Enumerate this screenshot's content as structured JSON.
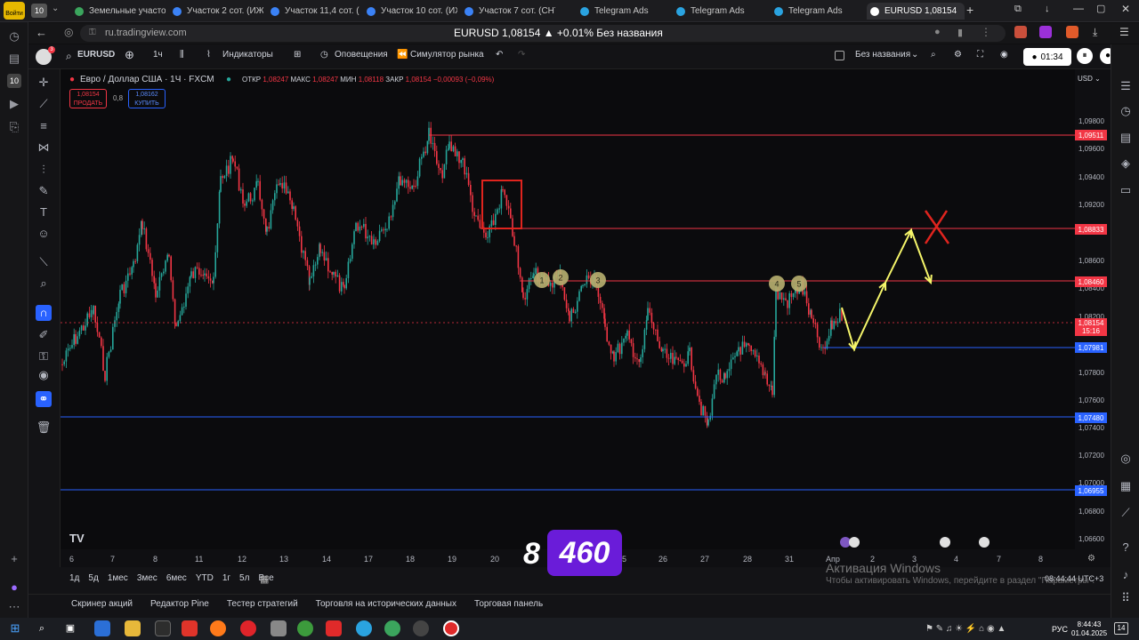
{
  "browser": {
    "tabs": [
      {
        "label": "Земельные участо",
        "color": "#3ba55d"
      },
      {
        "label": "Участок 2 сот. (ИЖ",
        "color": "#3b82f6"
      },
      {
        "label": "Участок 11,4 сот. (",
        "color": "#3b82f6"
      },
      {
        "label": "Участок 10 сот. (ИЖ",
        "color": "#3b82f6"
      },
      {
        "label": "Участок 7 сот. (СНТ",
        "color": "#3b82f6"
      },
      {
        "label": "Telegram Ads",
        "color": "#2aa3e0"
      },
      {
        "label": "Telegram Ads",
        "color": "#2aa3e0"
      },
      {
        "label": "Telegram Ads",
        "color": "#2aa3e0"
      },
      {
        "label": "EURUSD 1,08154",
        "color": "#ffffff"
      }
    ],
    "login_label": "Войти",
    "tab_counter": "10",
    "url": "ru.tradingview.com",
    "page_title": "EURUSD 1,08154 ▲ +0.01% Без названия"
  },
  "toolbar": {
    "symbol": "EURUSD",
    "interval": "1ч",
    "indicators": "Индикаторы",
    "alerts": "Оповещения",
    "replay": "Симулятор рынка",
    "layout_name": "Без названия",
    "timer": "01:34"
  },
  "legend": {
    "instrument": "Евро / Доллар США · 1Ч · FXCM",
    "open_label": "ОТКР",
    "open": "1,08247",
    "high_label": "МАКС",
    "high": "1,08247",
    "low_label": "МИН",
    "low": "1,08118",
    "close_label": "ЗАКР",
    "close": "1,08154",
    "change": "−0,00093 (−0,09%)",
    "sell_price": "1,08154",
    "sell_label": "ПРОДАТЬ",
    "spread": "0,8",
    "buy_price": "1,08162",
    "buy_label": "КУПИТЬ"
  },
  "currency": "USD",
  "y_ticks": [
    "1,09800",
    "1,09600",
    "1,09400",
    "1,09200",
    "1,09000",
    "1,08600",
    "1,08400",
    "1,08200",
    "1,07800",
    "1,07600",
    "1,07400",
    "1,07200",
    "1,07000",
    "1,06800",
    "1,06600"
  ],
  "price_tags": {
    "line1": "1,09511",
    "line2": "1,08833",
    "line3": "1,08460",
    "current": "1,08154",
    "countdown": "15:16",
    "line4": "1,07981",
    "line5": "1,07480",
    "line6": "1,06955"
  },
  "x_ticks": [
    "6",
    "7",
    "8",
    "11",
    "12",
    "13",
    "14",
    "17",
    "18",
    "19",
    "20",
    "25",
    "26",
    "27",
    "28",
    "31",
    "Апр",
    "2",
    "3",
    "4",
    "7",
    "8"
  ],
  "counter_overlay": {
    "left": "8",
    "right": "460"
  },
  "wave_points": [
    "1",
    "2",
    "3",
    "4",
    "5"
  ],
  "ranges": [
    "1д",
    "5д",
    "1мес",
    "3мес",
    "6мес",
    "YTD",
    "1г",
    "5л",
    "Все"
  ],
  "clock": "08:44:44 UTC+3",
  "panels": [
    "Скринер акций",
    "Редактор Pine",
    "Тестер стратегий",
    "Торговля на исторических данных",
    "Торговая панель"
  ],
  "watermark": {
    "title": "Активация Windows",
    "text": "Чтобы активировать Windows, перейдите в раздел \"Параметры\"."
  },
  "taskbar": {
    "lang": "РУС",
    "time": "8:44:43",
    "date": "01.04.2025",
    "notif": "14"
  },
  "colors": {
    "red": "#f23645",
    "blue": "#2962ff",
    "green": "#26a69a",
    "yellow": "#f5f56a"
  }
}
